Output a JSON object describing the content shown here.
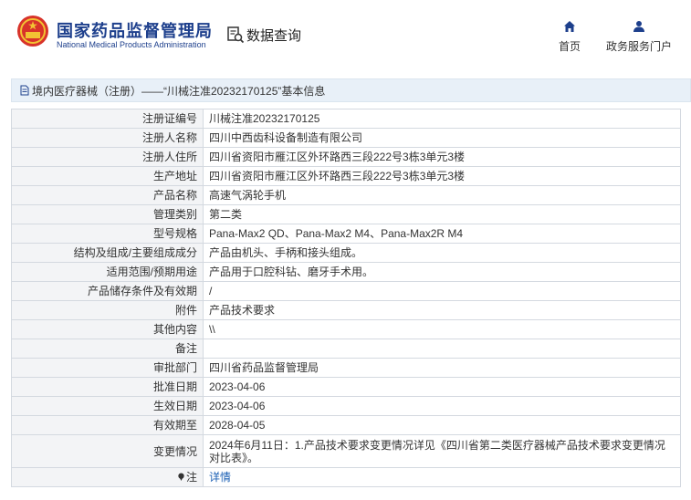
{
  "header": {
    "logo_cn": "国家药品监督管理局",
    "logo_en": "National Medical Products Administration",
    "search_label": "数据查询",
    "nav": {
      "home": "首页",
      "service": "政务服务门户"
    }
  },
  "breadcrumb": "境内医疗器械（注册）——“川械注准20232170125”基本信息",
  "rows": [
    {
      "label": "注册证编号",
      "value": "川械注准20232170125"
    },
    {
      "label": "注册人名称",
      "value": "四川中西齿科设备制造有限公司"
    },
    {
      "label": "注册人住所",
      "value": "四川省资阳市雁江区外环路西三段222号3栋3单元3楼"
    },
    {
      "label": "生产地址",
      "value": "四川省资阳市雁江区外环路西三段222号3栋3单元3楼"
    },
    {
      "label": "产品名称",
      "value": "高速气涡轮手机"
    },
    {
      "label": "管理类别",
      "value": "第二类"
    },
    {
      "label": "型号规格",
      "value": "Pana-Max2 QD、Pana-Max2 M4、Pana-Max2R M4"
    },
    {
      "label": "结构及组成/主要组成成分",
      "value": "产品由机头、手柄和接头组成。"
    },
    {
      "label": "适用范围/预期用途",
      "value": "产品用于口腔科钻、磨牙手术用。"
    },
    {
      "label": "产品储存条件及有效期",
      "value": "/"
    },
    {
      "label": "附件",
      "value": "产品技术要求"
    },
    {
      "label": "其他内容",
      "value": "\\\\"
    },
    {
      "label": "备注",
      "value": ""
    },
    {
      "label": "审批部门",
      "value": "四川省药品监督管理局"
    },
    {
      "label": "批准日期",
      "value": "2023-04-06"
    },
    {
      "label": "生效日期",
      "value": "2023-04-06"
    },
    {
      "label": "有效期至",
      "value": "2028-04-05"
    },
    {
      "label": "变更情况",
      "value": "2024年6月11日：1.产品技术要求变更情况详见《四川省第二类医疗器械产品技术要求变更情况对比表》。"
    }
  ],
  "note": {
    "label": "注",
    "link": "详情"
  },
  "colors": {
    "brand_blue": "#1d3f8c",
    "link_blue": "#1a5fb4",
    "label_bg": "#f3f4f6",
    "breadcrumb_bg": "#e8f0f8"
  }
}
